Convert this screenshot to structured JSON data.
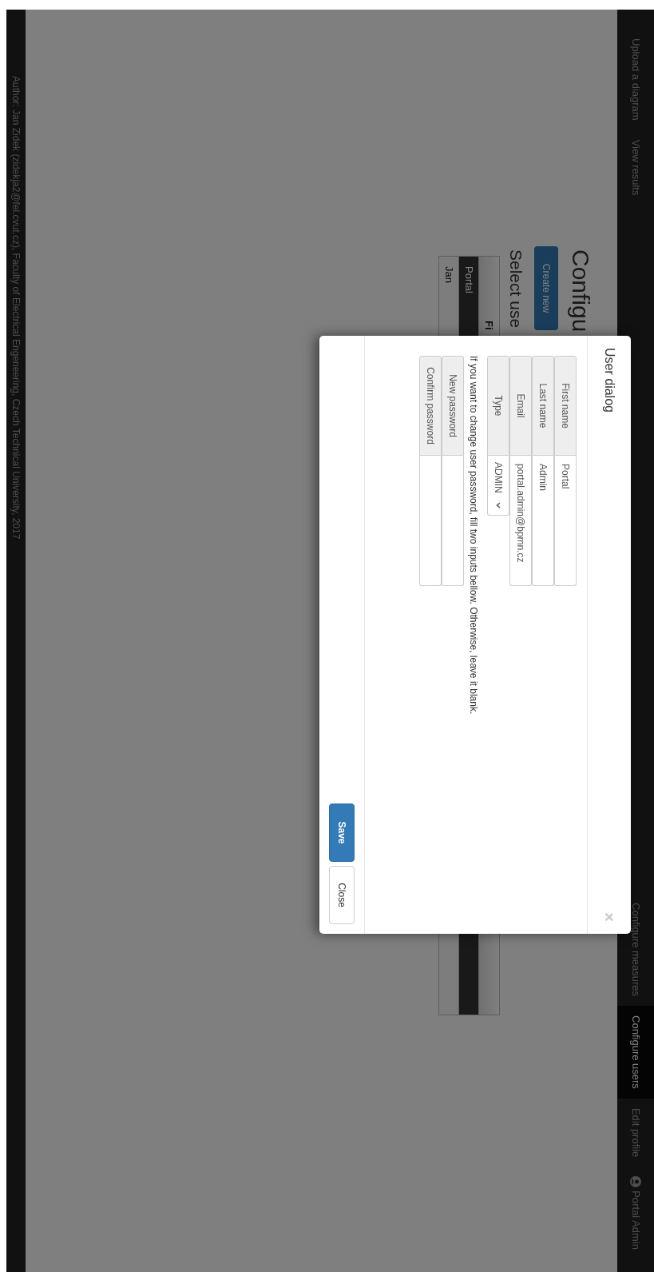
{
  "navbar": {
    "left_links": [
      {
        "label": "Upload a diagram",
        "selected": false
      },
      {
        "label": "View results",
        "selected": false
      }
    ],
    "right_links": [
      {
        "label": "Configure measures",
        "selected": false
      },
      {
        "label": "Configure users",
        "selected": true
      },
      {
        "label": "Edit profile",
        "selected": false
      }
    ],
    "user": {
      "label": "Portal Admin"
    }
  },
  "page": {
    "heading": "Configu",
    "create_button": "Create new",
    "subheading": "Select use",
    "table": {
      "header": "Fi",
      "rows": [
        {
          "cell": "Portal",
          "selected": true
        },
        {
          "cell": "Jan",
          "selected": false
        }
      ]
    }
  },
  "dialog": {
    "title": "User dialog",
    "close_label": "×",
    "fields": [
      {
        "kind": "text",
        "label": "First name",
        "value": "Portal"
      },
      {
        "kind": "text",
        "label": "Last name",
        "value": "Admin"
      },
      {
        "kind": "text",
        "label": "Email",
        "value": "portal.admin@bpmn.cz"
      },
      {
        "kind": "select",
        "label": "Type",
        "value": "ADMIN"
      }
    ],
    "help_text": "If you want to change user password, fill two inputs bellow. Otherwise, leave it blank.",
    "password_fields": [
      {
        "label": "New password"
      },
      {
        "label": "Confirm password"
      }
    ],
    "buttons": [
      {
        "kind": "primary",
        "label": "Save"
      },
      {
        "kind": "default",
        "label": "Close"
      }
    ]
  },
  "footer": {
    "text": "Author: Jan Zidek (zidekja2@fel.cvut.cz), Faculty of Electrical Engeneering, Czech Technical University, 2017"
  }
}
